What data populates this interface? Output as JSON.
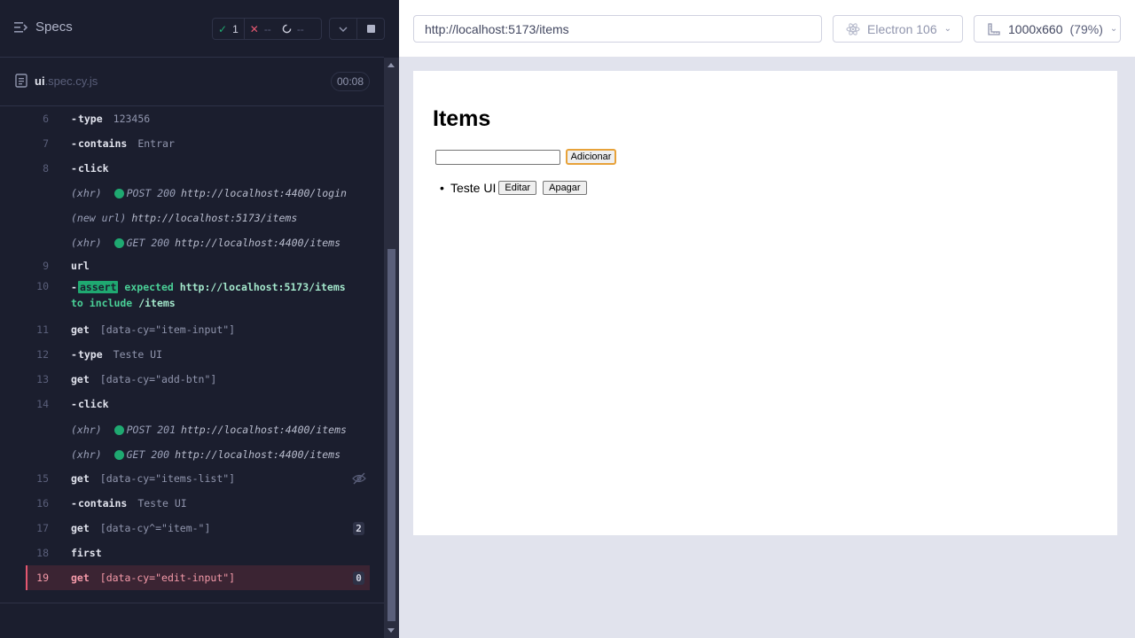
{
  "reporter": {
    "specs_label": "Specs",
    "stats": {
      "passed": "1",
      "failed": "--",
      "pending": "--"
    },
    "spec_file": {
      "name": "ui",
      "ext": ".spec.cy.js"
    },
    "duration": "00:08"
  },
  "commands": [
    {
      "num": "6",
      "kind": "child",
      "name": "type",
      "msg": "123456"
    },
    {
      "num": "7",
      "kind": "child",
      "name": "contains",
      "msg": "Entrar"
    },
    {
      "num": "8",
      "kind": "child",
      "name": "click",
      "msg": ""
    },
    {
      "num": "",
      "kind": "xhr",
      "label": "(xhr)",
      "status": "POST 200",
      "url": "http://localhost:4400/login"
    },
    {
      "num": "",
      "kind": "newurl",
      "label": "(new url)",
      "url": "http://localhost:5173/items"
    },
    {
      "num": "",
      "kind": "xhr",
      "label": "(xhr)",
      "status": "GET 200",
      "url": "http://localhost:4400/items"
    },
    {
      "num": "9",
      "kind": "parent",
      "name": "url",
      "msg": ""
    },
    {
      "num": "10",
      "kind": "assert",
      "tag": "assert",
      "text1": "expected",
      "url": "http://localhost:5173/items",
      "text2": "to include",
      "value": "/items"
    },
    {
      "num": "11",
      "kind": "parent",
      "name": "get",
      "msg": "[data-cy=\"item-input\"]"
    },
    {
      "num": "12",
      "kind": "child",
      "name": "type",
      "msg": "Teste UI"
    },
    {
      "num": "13",
      "kind": "parent",
      "name": "get",
      "msg": "[data-cy=\"add-btn\"]"
    },
    {
      "num": "14",
      "kind": "child",
      "name": "click",
      "msg": ""
    },
    {
      "num": "",
      "kind": "xhr",
      "label": "(xhr)",
      "status": "POST 201",
      "url": "http://localhost:4400/items"
    },
    {
      "num": "",
      "kind": "xhr",
      "label": "(xhr)",
      "status": "GET 200",
      "url": "http://localhost:4400/items"
    },
    {
      "num": "15",
      "kind": "parent",
      "name": "get",
      "msg": "[data-cy=\"items-list\"]",
      "icon": "eye-off-icon"
    },
    {
      "num": "16",
      "kind": "child",
      "name": "contains",
      "msg": "Teste UI"
    },
    {
      "num": "17",
      "kind": "parent",
      "name": "get",
      "msg": "[data-cy^=\"item-\"]",
      "badge": "2"
    },
    {
      "num": "18",
      "kind": "parent",
      "name": "first",
      "msg": ""
    },
    {
      "num": "19",
      "kind": "failed",
      "name": "get",
      "msg": "[data-cy=\"edit-input\"]",
      "badge": "0"
    }
  ],
  "aut": {
    "url": "http://localhost:5173/items",
    "browser": "Electron 106",
    "viewport": "1000x660",
    "scale": "(79%)"
  },
  "app": {
    "title": "Items",
    "add_button": "Adicionar",
    "items": [
      {
        "text": "Teste UI",
        "edit": "Editar",
        "delete": "Apagar"
      }
    ]
  },
  "colors": {
    "passed": "#1fa971",
    "failed": "#e45770",
    "reporter_bg": "#1b1e2e",
    "aut_bg": "#e1e3ed"
  }
}
